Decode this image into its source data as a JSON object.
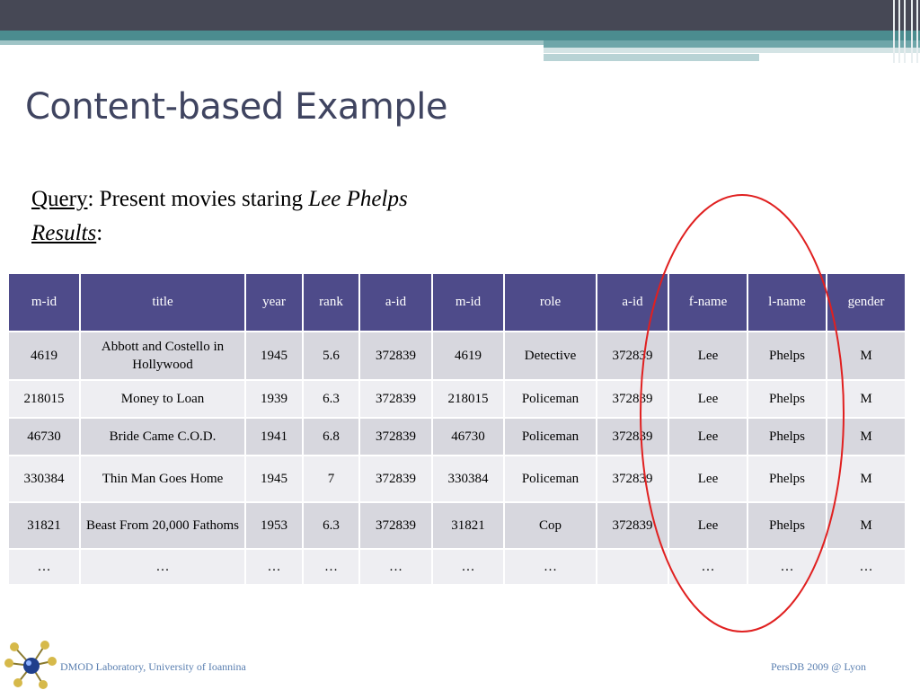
{
  "slide": {
    "title": "Content-based Example",
    "query_label": "Query",
    "query_text": ": Present movies staring ",
    "query_name": "Lee Phelps",
    "results_label": "Results",
    "results_colon": ":"
  },
  "table": {
    "headers": [
      "m-id",
      "title",
      "year",
      "rank",
      "a-id",
      "m-id",
      "role",
      "a-id",
      "f-name",
      "l-name",
      "gender"
    ],
    "rows": [
      [
        "4619",
        "Abbott and Costello in Hollywood",
        "1945",
        "5.6",
        "372839",
        "4619",
        "Detective",
        "372839",
        "Lee",
        "Phelps",
        "M"
      ],
      [
        "218015",
        "Money to Loan",
        "1939",
        "6.3",
        "372839",
        "218015",
        "Policeman",
        "372839",
        "Lee",
        "Phelps",
        "M"
      ],
      [
        "46730",
        "Bride Came C.O.D.",
        "1941",
        "6.8",
        "372839",
        "46730",
        "Policeman",
        "372839",
        "Lee",
        "Phelps",
        "M"
      ],
      [
        "330384",
        "Thin Man Goes Home",
        "1945",
        "7",
        "372839",
        "330384",
        "Policeman",
        "372839",
        "Lee",
        "Phelps",
        "M"
      ],
      [
        "31821",
        "Beast From 20,000 Fathoms",
        "1953",
        "6.3",
        "372839",
        "31821",
        "Cop",
        "372839",
        "Lee",
        "Phelps",
        "M"
      ],
      [
        "…",
        "…",
        "…",
        "…",
        "…",
        "…",
        "…",
        "",
        "…",
        "…",
        "…"
      ]
    ]
  },
  "annotation": {
    "shape": "ellipse",
    "color": "#e02020",
    "highlights": [
      "f-name",
      "l-name",
      "gender"
    ]
  },
  "footer": {
    "left": "DMOD Laboratory, University of Ioannina",
    "right": "PersDB 2009 @ Lyon"
  },
  "colors": {
    "header_bg": "#4e4b8a",
    "title": "#3f4460",
    "footer": "#5a7fb0",
    "topbar": "#464855",
    "teal": "#4b8c8f"
  }
}
